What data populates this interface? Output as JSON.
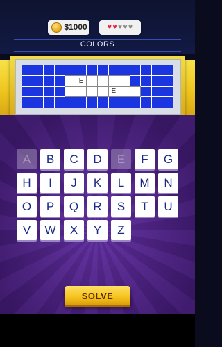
{
  "status": {
    "coins": "$1000",
    "lives_total": 5,
    "lives_remaining": 2
  },
  "category": "COLORS",
  "board": {
    "rows": 4,
    "cols": 14,
    "cells": [
      {
        "row": 1,
        "col": 4,
        "state": "blank"
      },
      {
        "row": 1,
        "col": 5,
        "state": "letter",
        "char": "E"
      },
      {
        "row": 1,
        "col": 6,
        "state": "blank"
      },
      {
        "row": 1,
        "col": 7,
        "state": "blank"
      },
      {
        "row": 1,
        "col": 8,
        "state": "blank"
      },
      {
        "row": 1,
        "col": 9,
        "state": "blank"
      },
      {
        "row": 2,
        "col": 4,
        "state": "blank"
      },
      {
        "row": 2,
        "col": 5,
        "state": "blank"
      },
      {
        "row": 2,
        "col": 6,
        "state": "blank"
      },
      {
        "row": 2,
        "col": 7,
        "state": "blank"
      },
      {
        "row": 2,
        "col": 8,
        "state": "letter",
        "char": "E"
      },
      {
        "row": 2,
        "col": 9,
        "state": "blank"
      },
      {
        "row": 2,
        "col": 10,
        "state": "blank"
      }
    ]
  },
  "keyboard": [
    {
      "letter": "A",
      "used": true
    },
    {
      "letter": "B",
      "used": false
    },
    {
      "letter": "C",
      "used": false
    },
    {
      "letter": "D",
      "used": false
    },
    {
      "letter": "E",
      "used": true
    },
    {
      "letter": "F",
      "used": false
    },
    {
      "letter": "G",
      "used": false
    },
    {
      "letter": "H",
      "used": false
    },
    {
      "letter": "I",
      "used": false
    },
    {
      "letter": "J",
      "used": false
    },
    {
      "letter": "K",
      "used": false
    },
    {
      "letter": "L",
      "used": false
    },
    {
      "letter": "M",
      "used": false
    },
    {
      "letter": "N",
      "used": false
    },
    {
      "letter": "O",
      "used": false
    },
    {
      "letter": "P",
      "used": false
    },
    {
      "letter": "Q",
      "used": false
    },
    {
      "letter": "R",
      "used": false
    },
    {
      "letter": "S",
      "used": false
    },
    {
      "letter": "T",
      "used": false
    },
    {
      "letter": "U",
      "used": false
    },
    {
      "letter": "V",
      "used": false
    },
    {
      "letter": "W",
      "used": false
    },
    {
      "letter": "X",
      "used": false
    },
    {
      "letter": "Y",
      "used": false
    },
    {
      "letter": "Z",
      "used": false
    }
  ],
  "solve_label": "SOLVE",
  "colors": {
    "board_blue": "#1b35e0",
    "heart_red": "#e3243b",
    "button_yellow": "#f4c21a",
    "stage_purple": "#5c2b97"
  },
  "icons": {
    "coin": "gold-coin-icon",
    "life": "heart-icon"
  }
}
